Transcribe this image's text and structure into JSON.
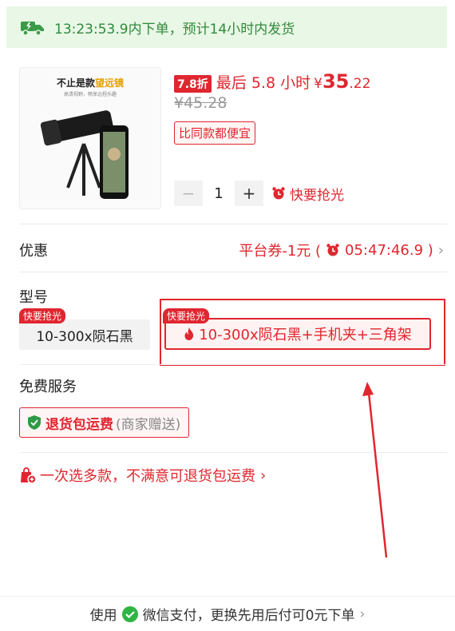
{
  "shipping_banner": {
    "text": "13:23:53.9内下单，预计14小时内发货"
  },
  "product": {
    "image_title_prefix": "不止是款",
    "image_title_highlight": "望远镜",
    "image_subtitle": "高清视野，畅享远程乐趣",
    "discount_badge": "7.8折",
    "last_hours": "最后 5.8 小时",
    "currency": "¥",
    "price_int": "35",
    "price_dec": ".22",
    "original_price": "¥45.28",
    "cheaper_tag": "比同款都便宜",
    "quantity": "1",
    "minus_label": "−",
    "plus_label": "+",
    "hurry_label": "快要抢光"
  },
  "promo": {
    "label": "优惠",
    "coupon": "平台券-1元 (",
    "countdown": "05:47:46.9 )",
    "chevron": "›"
  },
  "model": {
    "label": "型号",
    "options": [
      {
        "ribbon": "快要抢光",
        "label": "10-300x陨石黑",
        "selected": false
      },
      {
        "ribbon": "快要抢光",
        "label": "10-300x陨石黑+手机夹+三角架",
        "selected": true
      }
    ]
  },
  "service": {
    "label": "免费服务",
    "tag_main": "退货包运费",
    "tag_sub": "(商家赠送)"
  },
  "multi_select": {
    "text": "一次选多款，不满意可退货包运费",
    "chevron": "›"
  },
  "footer": {
    "prefix": "使用",
    "pay": "微信支付，更换先用后付可0元下单",
    "chevron": "›"
  },
  "colors": {
    "accent": "#e0262f",
    "green": "#2f8a3b",
    "banner_bg": "#e9f7e6"
  }
}
